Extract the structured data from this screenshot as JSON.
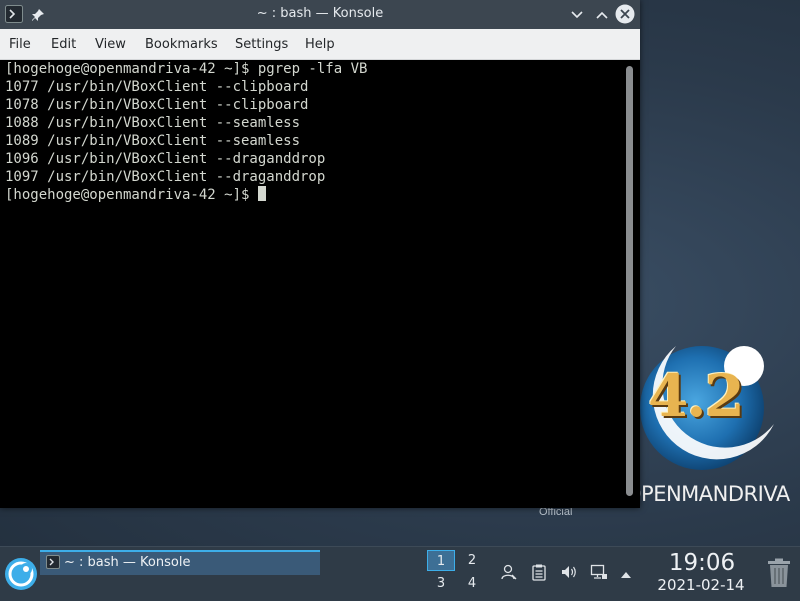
{
  "window": {
    "title": "~ : bash — Konsole"
  },
  "menu": {
    "items": [
      "File",
      "Edit",
      "View",
      "Bookmarks",
      "Settings",
      "Help"
    ]
  },
  "terminal": {
    "lines": [
      "[hogehoge@openmandriva-42 ~]$ pgrep -lfa VB",
      "1077 /usr/bin/VBoxClient --clipboard",
      "1078 /usr/bin/VBoxClient --clipboard",
      "1088 /usr/bin/VBoxClient --seamless",
      "1089 /usr/bin/VBoxClient --seamless",
      "1096 /usr/bin/VBoxClient --draganddrop",
      "1097 /usr/bin/VBoxClient --draganddrop",
      "[hogehoge@openmandriva-42 ~]$"
    ]
  },
  "desktop": {
    "logo_number": "4.2",
    "logo_wordmark": "OPENMANDRIVA",
    "official_label": "Official"
  },
  "taskbar": {
    "task_label": "~ : bash — Konsole",
    "desktops": [
      "1",
      "2",
      "3",
      "4"
    ],
    "clock_time": "19:06",
    "clock_date": "2021-02-14"
  },
  "icons": {
    "window_app": "konsole-icon",
    "pin": "pin-icon",
    "minimize": "chevron-down-icon",
    "maximize": "chevron-up-icon",
    "close": "close-icon",
    "launcher": "openmandriva-launcher-icon",
    "trash": "trash-icon"
  },
  "colors": {
    "accent": "#3daee9",
    "titlebar": "#3c4650",
    "terminal_bg": "#000000",
    "terminal_fg": "#d3d7cf",
    "taskbar": "#2f3b47"
  }
}
